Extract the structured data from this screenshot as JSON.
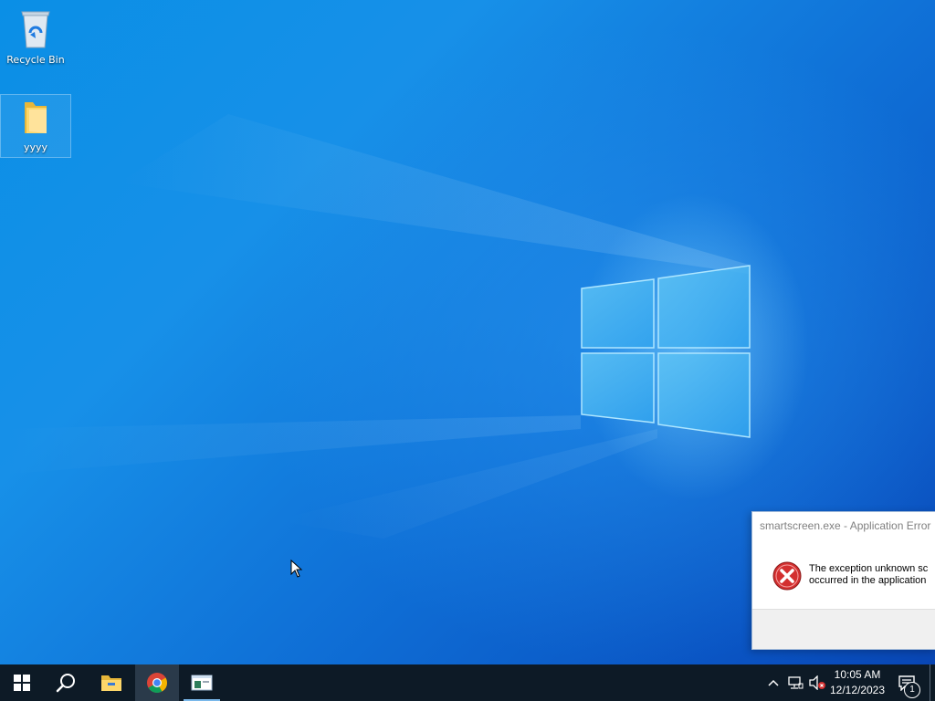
{
  "desktop": {
    "icons": [
      {
        "label": "Recycle Bin",
        "icon": "recycle-bin-icon"
      },
      {
        "label": "yyyy",
        "icon": "folder-icon"
      }
    ]
  },
  "dialog": {
    "title": "smartscreen.exe - Application Error",
    "message_line1": "The exception unknown sc",
    "message_line2": "occurred in the application",
    "icon": "error-icon"
  },
  "taskbar": {
    "apps": [
      {
        "name": "Start",
        "icon": "windows-start-icon"
      },
      {
        "name": "Search",
        "icon": "search-icon"
      },
      {
        "name": "File Explorer",
        "icon": "file-explorer-icon"
      },
      {
        "name": "Google Chrome",
        "icon": "chrome-icon"
      },
      {
        "name": "Open window",
        "icon": "app-window-icon"
      }
    ],
    "tray": {
      "icons": [
        "chevron-up-icon",
        "network-icon",
        "volume-muted-icon"
      ],
      "time": "10:05 AM",
      "date": "12/12/2023",
      "notification_count": "1"
    }
  },
  "colors": {
    "taskbar": "#0d1a26",
    "accent": "#7ab8ea",
    "error_red": "#d32f2f"
  }
}
